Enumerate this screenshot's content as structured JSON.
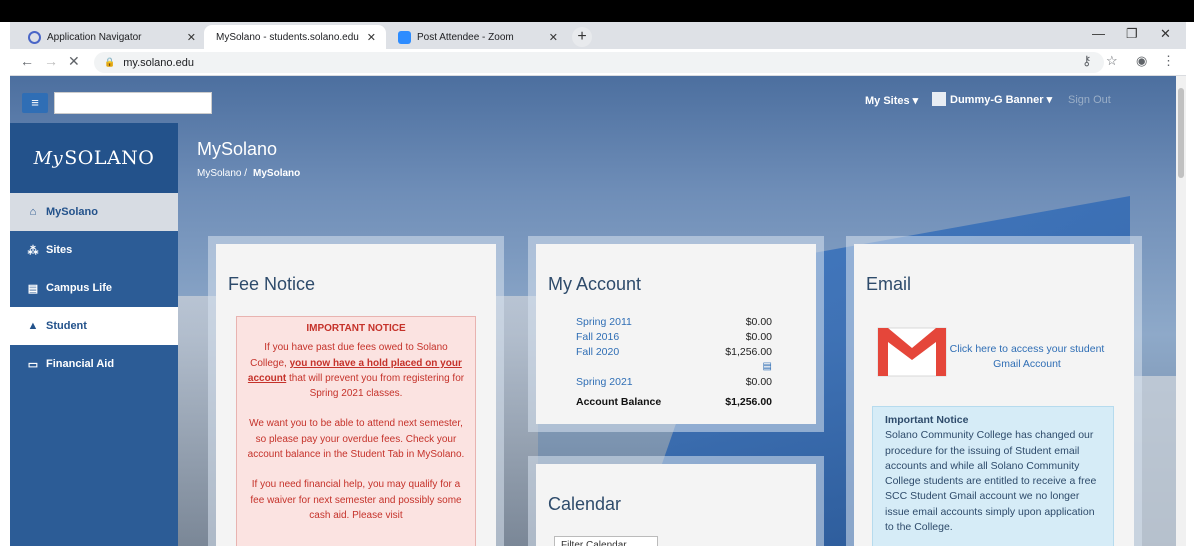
{
  "browser": {
    "tabs": [
      {
        "title": "Application Navigator",
        "close": "✕"
      },
      {
        "title": "MySolano - students.solano.edu",
        "close": "✕"
      },
      {
        "title": "Post Attendee - Zoom",
        "close": "✕"
      }
    ],
    "new_tab": "+",
    "url": "my.solano.edu",
    "controls": {
      "minimize": "—",
      "restore": "❐",
      "close": "✕"
    }
  },
  "header": {
    "my_sites": "My Sites ▾",
    "user": "Dummy-G Banner ▾",
    "sign_out": "Sign Out"
  },
  "sidebar": {
    "logo_prefix": "My",
    "logo_main": "SOLANO",
    "items": [
      {
        "label": "MySolano",
        "icon": "home-icon",
        "glyph": "⌂"
      },
      {
        "label": "Sites",
        "icon": "sitemap-icon",
        "glyph": "⁂"
      },
      {
        "label": "Campus Life",
        "icon": "book-icon",
        "glyph": "▤"
      },
      {
        "label": "Student",
        "icon": "graduation-cap-icon",
        "glyph": "🎓"
      },
      {
        "label": "Financial Aid",
        "icon": "credit-card-icon",
        "glyph": "▭"
      }
    ]
  },
  "page": {
    "title": "MySolano",
    "breadcrumb_root": "MySolano /",
    "breadcrumb_current": "MySolano"
  },
  "fee_notice": {
    "title": "Fee Notice",
    "heading": "IMPORTANT NOTICE",
    "p1_a": "If you have past due fees owed to Solano College,",
    "p1_hold": "you now have a hold placed on your account",
    "p1_b": "that will prevent you from registering for Spring 2021 classes.",
    "p2": "We want you to be able to attend next semester, so please pay your overdue fees. Check your account balance in the Student Tab in MySolano.",
    "p3": "If you need financial help, you may qualify for a fee waiver for next semester and possibly some cash aid. Please visit"
  },
  "account": {
    "title": "My Account",
    "rows": [
      {
        "term": "Spring 2011",
        "amount": "$0.00"
      },
      {
        "term": "Fall 2016",
        "amount": "$0.00"
      },
      {
        "term": "Fall 2020",
        "amount": "$1,256.00"
      },
      {
        "term": "Spring 2021",
        "amount": "$0.00"
      }
    ],
    "balance_label": "Account Balance",
    "balance_value": "$1,256.00"
  },
  "email": {
    "title": "Email",
    "link": "Click here to access your student Gmail Account",
    "notice_heading": "Important Notice",
    "notice_body": "Solano Community College has changed our procedure for the issuing of Student email accounts and while all Solano Community College students are entitled to receive a free SCC Student Gmail account we no longer issue email accounts simply upon application to the College."
  },
  "calendar": {
    "title": "Calendar",
    "filter": "Filter Calendar"
  },
  "colors": {
    "brand_blue": "#2c5c96",
    "link_blue": "#2f6eb5",
    "alert_red": "#c5322a"
  }
}
